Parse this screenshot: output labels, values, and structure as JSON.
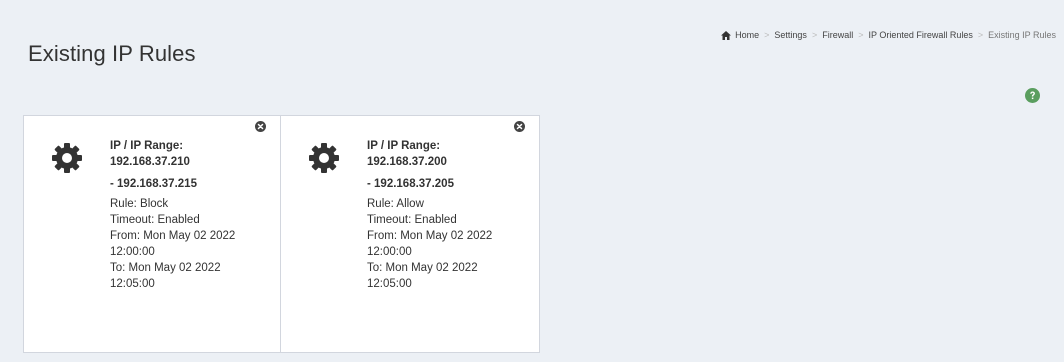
{
  "header": {
    "title": "Existing IP Rules"
  },
  "breadcrumb": [
    {
      "label": "Home"
    },
    {
      "label": "Settings"
    },
    {
      "label": "Firewall"
    },
    {
      "label": "IP Oriented Firewall Rules"
    },
    {
      "label": "Existing IP Rules"
    }
  ],
  "colors": {
    "help_icon": "#5a9e5f",
    "gear_icon": "#333333",
    "close_icon": "#444444"
  },
  "rules": [
    {
      "ip_label": "IP / IP Range:",
      "ip_start": "192.168.37.210",
      "ip_end": "- 192.168.37.215",
      "rule": "Rule: Block",
      "timeout": "Timeout: Enabled",
      "from_label": "From: Mon May 02 2022",
      "from_time": "12:00:00",
      "to_label": "To: Mon May 02 2022",
      "to_time": "12:05:00"
    },
    {
      "ip_label": "IP / IP Range:",
      "ip_start": "192.168.37.200",
      "ip_end": "- 192.168.37.205",
      "rule": "Rule: Allow",
      "timeout": "Timeout: Enabled",
      "from_label": "From: Mon May 02 2022",
      "from_time": "12:00:00",
      "to_label": "To: Mon May 02 2022",
      "to_time": "12:05:00"
    }
  ]
}
